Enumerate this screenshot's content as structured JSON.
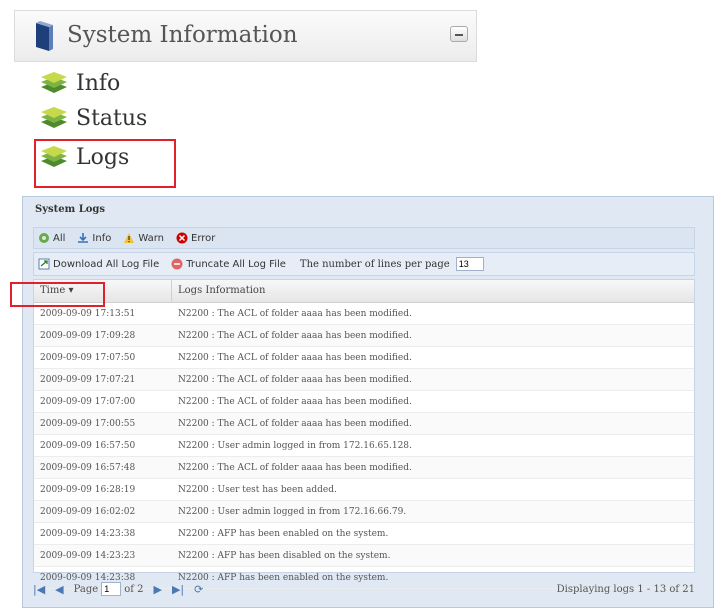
{
  "header": {
    "title": "System Information"
  },
  "nav": {
    "info": "Info",
    "status": "Status",
    "logs": "Logs"
  },
  "logs_panel": {
    "title": "System Logs",
    "filters": {
      "all": "All",
      "info": "Info",
      "warn": "Warn",
      "error": "Error"
    },
    "actions": {
      "download": "Download All Log File",
      "truncate": "Truncate All Log File",
      "lines_label": "The number of lines per page",
      "lines_value": "13"
    },
    "columns": {
      "time": "Time ▾",
      "info": "Logs Information"
    },
    "rows": [
      {
        "time": "2009-09-09 17:13:51",
        "info": "N2200 : The ACL of folder aaaa has been modified."
      },
      {
        "time": "2009-09-09 17:09:28",
        "info": "N2200 : The ACL of folder aaaa has been modified."
      },
      {
        "time": "2009-09-09 17:07:50",
        "info": "N2200 : The ACL of folder aaaa has been modified."
      },
      {
        "time": "2009-09-09 17:07:21",
        "info": "N2200 : The ACL of folder aaaa has been modified."
      },
      {
        "time": "2009-09-09 17:07:00",
        "info": "N2200 : The ACL of folder aaaa has been modified."
      },
      {
        "time": "2009-09-09 17:00:55",
        "info": "N2200 : The ACL of folder aaaa has been modified."
      },
      {
        "time": "2009-09-09 16:57:50",
        "info": "N2200 : User admin logged in from 172.16.65.128."
      },
      {
        "time": "2009-09-09 16:57:48",
        "info": "N2200 : The ACL of folder aaaa has been modified."
      },
      {
        "time": "2009-09-09 16:28:19",
        "info": "N2200 : User test has been added."
      },
      {
        "time": "2009-09-09 16:02:02",
        "info": "N2200 : User admin logged in from 172.16.66.79."
      },
      {
        "time": "2009-09-09 14:23:38",
        "info": "N2200 : AFP has been enabled on the system."
      },
      {
        "time": "2009-09-09 14:23:23",
        "info": "N2200 : AFP has been disabled on the system."
      },
      {
        "time": "2009-09-09 14:23:38",
        "info": "N2200 : AFP has been enabled on the system."
      }
    ],
    "pager": {
      "page_label": "Page",
      "page_value": "1",
      "of_label": "of 2",
      "status": "Displaying logs 1 - 13 of 21"
    }
  },
  "colors": {
    "highlight": "#e0212b",
    "panel_bg": "#dfe8f3"
  }
}
